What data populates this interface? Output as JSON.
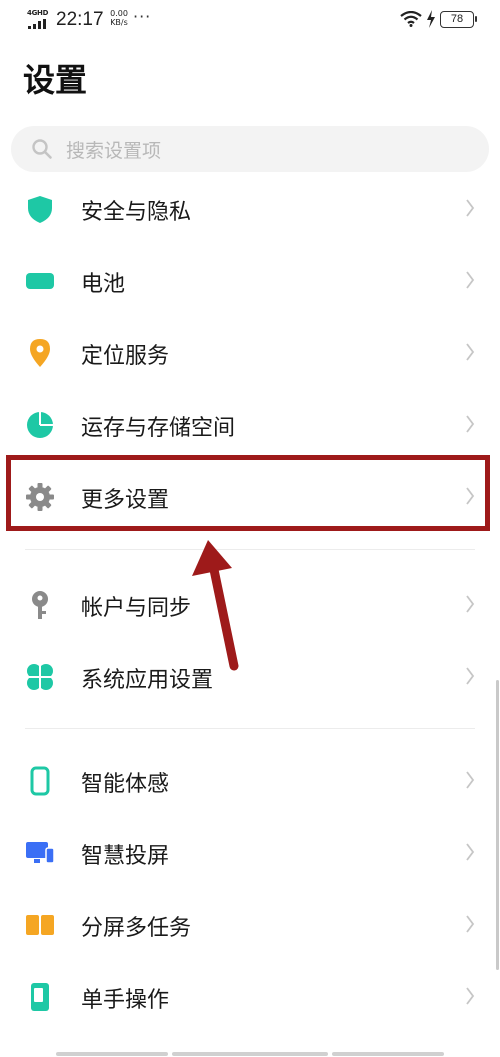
{
  "status_bar": {
    "network": "4GHD",
    "time": "22:17",
    "speed_value": "0.00",
    "speed_unit": "KB/s",
    "more": "···",
    "battery": "78"
  },
  "header": {
    "title": "设置"
  },
  "search": {
    "placeholder": "搜索设置项"
  },
  "items": [
    {
      "label": "安全与隐私",
      "icon": "shield-icon",
      "color": "#1ec8a5"
    },
    {
      "label": "电池",
      "icon": "battery-icon",
      "color": "#1ec8a5"
    },
    {
      "label": "定位服务",
      "icon": "location-pin-icon",
      "color": "#f5a623"
    },
    {
      "label": "运存与存储空间",
      "icon": "pie-chart-icon",
      "color": "#1ec8a5"
    },
    {
      "label": "更多设置",
      "icon": "gear-icon",
      "color": "#8a8a8a"
    },
    {
      "label": "帐户与同步",
      "icon": "key-icon",
      "color": "#8a8a8a"
    },
    {
      "label": "系统应用设置",
      "icon": "clover-icon",
      "color": "#1ec8a5"
    },
    {
      "label": "智能体感",
      "icon": "phone-outline-icon",
      "color": "#1ec8a5"
    },
    {
      "label": "智慧投屏",
      "icon": "screen-cast-icon",
      "color": "#3b6ff5"
    },
    {
      "label": "分屏多任务",
      "icon": "split-screen-icon",
      "color": "#f5a623"
    },
    {
      "label": "单手操作",
      "icon": "one-hand-icon",
      "color": "#1ec8a5"
    }
  ],
  "annotation": {
    "highlight_color": "#9e1a1a"
  }
}
